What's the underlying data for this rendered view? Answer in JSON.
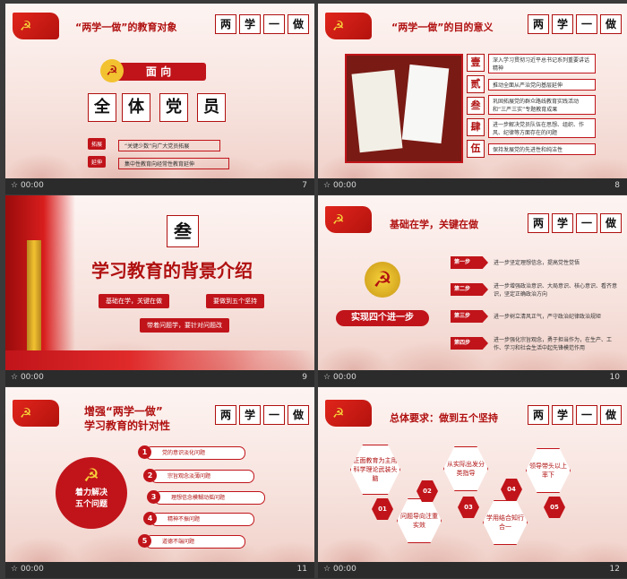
{
  "slides": [
    {
      "number": "7",
      "time": "00:00",
      "title": "“两学一做”的教育对象",
      "xue": [
        "两",
        "学",
        "一",
        "做"
      ],
      "face_label": "面  向",
      "boxes": [
        "全",
        "体",
        "党",
        "员"
      ],
      "rows": [
        {
          "tag": "拓展",
          "text": "“关键少数”向广大党员拓展"
        },
        {
          "tag": "延伸",
          "text": "集中性教育向经常性教育延伸"
        }
      ]
    },
    {
      "number": "8",
      "time": "00:00",
      "title": "“两学一做”的目的意义",
      "xue": [
        "两",
        "学",
        "一",
        "做"
      ],
      "chars": [
        "壹",
        "贰",
        "叁",
        "肆",
        "伍"
      ],
      "items": [
        "深入学习贯彻习近平总书记系列重要讲话精神",
        "推动全面从严治党向基层延伸",
        "巩固拓展党的群众路线教育实践活动和“三严三实”专题教育成果",
        "进一步解决党员队伍在思想、组织、作风、纪律等方面存在的问题",
        "保持发展党的先进性和纯洁性"
      ]
    },
    {
      "number": "9",
      "time": "00:00",
      "big_char": "叁",
      "title": "学习教育的背景介绍",
      "points": [
        "基础在学，关键在做",
        "要做到五个坚持",
        "带着问题学，要针对问题改"
      ]
    },
    {
      "number": "10",
      "time": "00:00",
      "title": "基础在学，关键在做",
      "xue": [
        "两",
        "学",
        "一",
        "做"
      ],
      "center": "实现四个进一步",
      "steps": [
        {
          "label": "第一步",
          "text": "进一步坚定理想信念，提高党性觉悟"
        },
        {
          "label": "第二步",
          "text": "进一步增强政治意识、大局意识、核心意识、看齐意识，坚定正确政治方向"
        },
        {
          "label": "第三步",
          "text": "进一步树立清风正气，严守政治纪律政治规矩"
        },
        {
          "label": "第四步",
          "text": "进一步强化宗旨观念，勇于担当作为，在生产、工作、学习和社会生活中起先锋模范作用"
        }
      ]
    },
    {
      "number": "11",
      "time": "00:00",
      "title_line1": "增强“两学一做”",
      "title_line2": "学习教育的针对性",
      "xue": [
        "两",
        "学",
        "一",
        "做"
      ],
      "center_line1": "着力解决",
      "center_line2": "五个问题",
      "problems": [
        {
          "n": "1",
          "text": "党的意识淡化问题"
        },
        {
          "n": "2",
          "text": "宗旨观念淡薄问题"
        },
        {
          "n": "3",
          "text": "理想信念模糊动摇问题"
        },
        {
          "n": "4",
          "text": "精神不振问题"
        },
        {
          "n": "5",
          "text": "道德不端问题"
        }
      ]
    },
    {
      "number": "12",
      "time": "00:00",
      "title": "总体要求：做到五个坚持",
      "xue": [
        "两",
        "学",
        "一",
        "做"
      ],
      "hex": [
        {
          "n": "01",
          "text": "正面教育为主用科学理论武装头脑"
        },
        {
          "n": "02",
          "text": "问题导向注重实效"
        },
        {
          "n": "03",
          "text": "从实际出发分类指导"
        },
        {
          "n": "04",
          "text": "学用结合知行合一"
        },
        {
          "n": "05",
          "text": "领导带头以上率下"
        }
      ]
    }
  ]
}
